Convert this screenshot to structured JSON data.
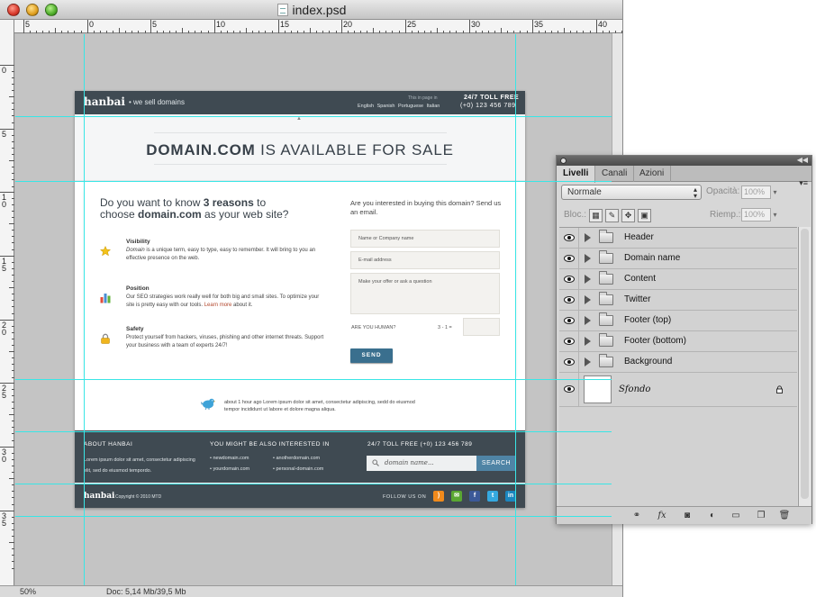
{
  "window": {
    "title": "index.psd"
  },
  "ruler": {
    "h_labels": [
      "5",
      "0",
      "5",
      "10",
      "15",
      "20",
      "25",
      "30",
      "35",
      "40"
    ],
    "v_labels": [
      "0",
      "5",
      "1 0",
      "1 5",
      "2 0",
      "2 5",
      "3 0",
      "3 5"
    ]
  },
  "status": {
    "zoom": "50%",
    "doc": "Doc: 5,14 Mb/39,5 Mb"
  },
  "page": {
    "header": {
      "logo": "hanbai",
      "tagline": "•  we sell domains",
      "lang_title": "This in page in",
      "languages": "English  Spanish  Portuguese  Italian",
      "toll": "24/7 TOLL FREE",
      "phone": "(+0) 123 456 789"
    },
    "hero": {
      "bold": "DOMAIN.COM",
      "rest": " IS AVAILABLE FOR SALE",
      "arrow": "▲"
    },
    "question": {
      "l1a": "Do you want to know ",
      "l1b": "3 reasons",
      "l1c": " to",
      "l2a": "choose ",
      "l2b": "domain.com",
      "l2c": " as your web site?"
    },
    "features": [
      {
        "title": "Visibility",
        "em": "Domain",
        "text": " is a unique term, easy to type, easy to remember. It will bring to you an effective presence on the web."
      },
      {
        "title": "Position",
        "text": "Our SEO strategies work really well for both big and small sites. To optimize your site is pretty easy with our tools. ",
        "link": "Learn more",
        "after": " about it."
      },
      {
        "title": "Safety",
        "text": "Protect yourself from hackers, viruses, phishing and other internet threats. Support your business with a team of experts 24/7!"
      }
    ],
    "form": {
      "intro": "Are you interested in buying this domain? Send us an email.",
      "name_placeholder": "Name or Company name",
      "email_placeholder": "E-mail address",
      "message_placeholder": "Make your offer or ask a question",
      "human_label": "ARE YOU HUMAN?",
      "captcha": "3 - 1 =",
      "send": "SEND"
    },
    "tweet": "about 1 hour ago Lorem ipsum dolor sit amet, consectetur adipiscing, sedd do eiusmod tempor incididunt ut labore et dolore magna aliqua.",
    "footer": {
      "about_title": "ABOUT HANBAI",
      "about_text": "Lorem ipsum dolor sit amet, consectetur adipiscing elit, sed do eiusmod tempordo.",
      "interest_title": "YOU MIGHT BE ALSO INTERESTED IN",
      "links": [
        "newdomain.com",
        "yourdomain.com",
        "anotherdomain.com",
        "personal-domain.com"
      ],
      "toll": "24/7 TOLL FREE (+0) 123 456 789",
      "search_placeholder": "domain name...",
      "search_button": "SEARCH",
      "logo": "hanbai",
      "copyright": "Copyright © 2010 MTD",
      "follow": "FOLLOW US ON",
      "social": [
        {
          "name": "rss",
          "color": "#f08a1c"
        },
        {
          "name": "chat",
          "color": "#5aa832"
        },
        {
          "name": "facebook",
          "color": "#3b5998"
        },
        {
          "name": "twitter",
          "color": "#35a9e0"
        },
        {
          "name": "linkedin",
          "color": "#1b86bf"
        }
      ]
    }
  },
  "panel": {
    "tabs": [
      "Livelli",
      "Canali",
      "Azioni"
    ],
    "blend_mode": "Normale",
    "opacity_label": "Opacità:",
    "opacity_value": "100%",
    "lock_label": "Bloc.:",
    "fill_label": "Riemp.:",
    "fill_value": "100%",
    "layers": [
      "Header",
      "Domain name",
      "Content",
      "Twitter",
      "Footer (top)",
      "Footer (bottom)",
      "Background"
    ],
    "background_layer": "Sfondo"
  }
}
